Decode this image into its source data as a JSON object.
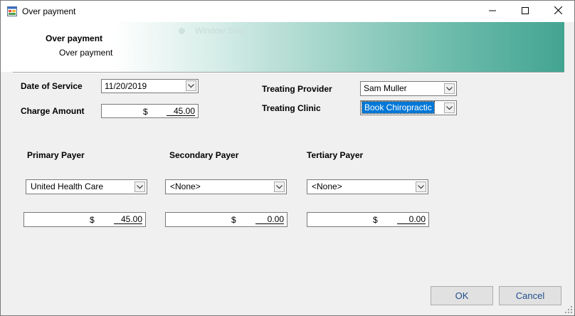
{
  "window": {
    "title": "Over payment",
    "app_icon": "form-icon",
    "controls": {
      "minimize_icon": "minimize-icon",
      "maximize_icon": "maximize-icon",
      "close_icon": "close-icon"
    }
  },
  "header": {
    "title": "Over payment",
    "subtitle": "Over payment",
    "ghost_text": "Window Snip"
  },
  "fields": {
    "date_of_service": {
      "label": "Date of Service",
      "value": "11/20/2019"
    },
    "charge_amount": {
      "label": "Charge Amount",
      "currency": "$",
      "value": "45.00"
    },
    "treating_provider": {
      "label": "Treating Provider",
      "value": "Sam Muller"
    },
    "treating_clinic": {
      "label": "Treating Clinic",
      "value": "Book Chiropractic"
    }
  },
  "payers": {
    "primary": {
      "label": "Primary Payer",
      "selected": "United Health Care",
      "currency": "$",
      "amount": "45.00"
    },
    "secondary": {
      "label": "Secondary Payer",
      "selected": "<None>",
      "currency": "$",
      "amount": "0.00"
    },
    "tertiary": {
      "label": "Tertiary Payer",
      "selected": "<None>",
      "currency": "$",
      "amount": "0.00"
    }
  },
  "buttons": {
    "ok": "OK",
    "cancel": "Cancel"
  },
  "colors": {
    "banner_accent": "#43a492",
    "selection": "#0078d7",
    "button_text": "#1f4e8c"
  }
}
